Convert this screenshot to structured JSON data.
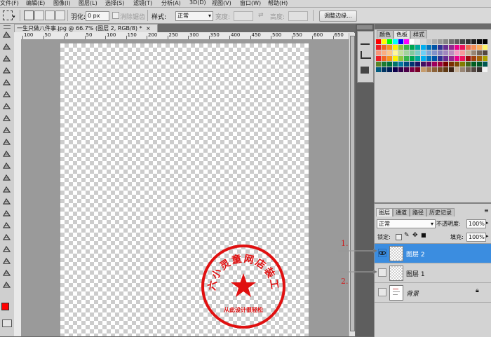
{
  "menubar": {
    "items": [
      "文件(F)",
      "编辑(E)",
      "图像(I)",
      "图层(L)",
      "选择(S)",
      "滤镜(T)",
      "分析(A)",
      "3D(D)",
      "视图(V)",
      "窗口(W)",
      "帮助(H)"
    ]
  },
  "options": {
    "feather_label": "羽化:",
    "feather_value": "0 px",
    "antialias_label": "消除锯齿",
    "style_label": "样式:",
    "style_value": "正常",
    "width_label": "宽度:",
    "height_label": "高度:",
    "refine_button": "调整边缘..."
  },
  "document": {
    "tab_title": "一生只做八件事.jpg @ 66.7% (图层 2, RGB/8) *",
    "close_glyph": "×",
    "ruler_ticks": [
      "100",
      "50",
      "0",
      "50",
      "100",
      "150",
      "200",
      "250",
      "300",
      "350",
      "400",
      "450",
      "500",
      "550",
      "600",
      "650"
    ]
  },
  "stamp": {
    "top_text": "六小灵童网店装工",
    "bottom_text": "从此设计很轻松",
    "color": "#e01010"
  },
  "swatches_panel": {
    "tabs": [
      "颜色",
      "色板",
      "样式"
    ],
    "active_tab": "色板"
  },
  "layers_panel": {
    "tabs": [
      "图层",
      "通道",
      "路径",
      "历史记录"
    ],
    "blend_mode": "正常",
    "opacity_label": "不透明度:",
    "opacity_value": "100%",
    "lock_label": "锁定:",
    "fill_label": "填充:",
    "fill_value": "100%",
    "layers": [
      {
        "name": "图层 2",
        "selected": true,
        "visible": true
      },
      {
        "name": "图层 1",
        "selected": false,
        "visible": false
      },
      {
        "name": "背景",
        "selected": false,
        "visible": false,
        "locked": true
      }
    ]
  },
  "annotations": {
    "one": "1.",
    "two": "2."
  },
  "colors": {
    "foreground": "#ff0000",
    "background": "#ffffff",
    "selection": "#3b8de0"
  }
}
